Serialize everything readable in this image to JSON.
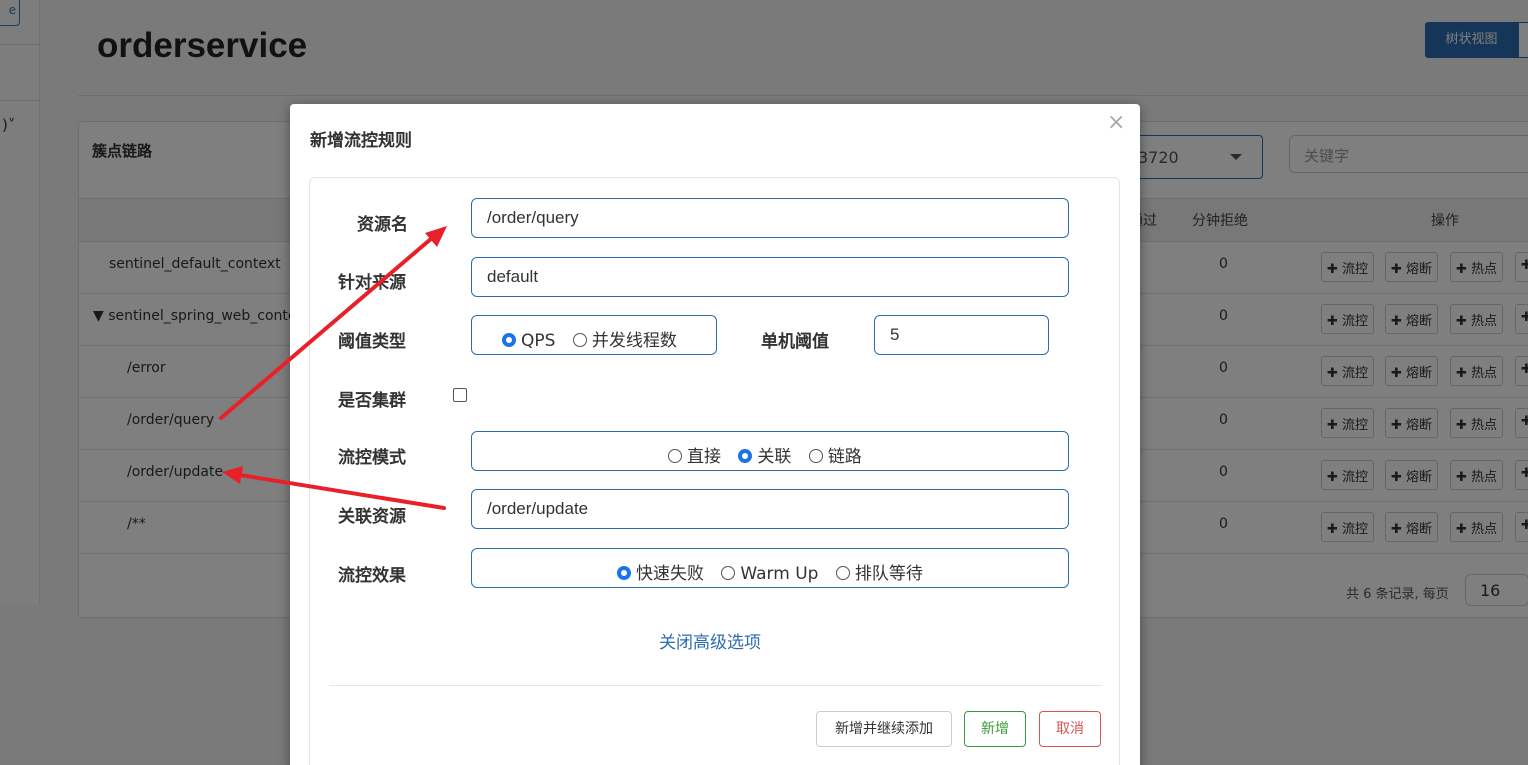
{
  "left_rail": {
    "button_label": "e",
    "caret": ")˅"
  },
  "header": {
    "title": "orderservice",
    "tree_view_button": "树状视图"
  },
  "panel": {
    "title": "簇点链路",
    "machine_select": "3720",
    "keyword_placeholder": "关键字",
    "columns": {
      "passed": "通过",
      "rejected": "分钟拒绝",
      "ops": "操作"
    },
    "rows": [
      {
        "name": "sentinel_default_context",
        "rejected": "0"
      },
      {
        "name": "▼ sentinel_spring_web_conte",
        "rejected": "0"
      },
      {
        "name": "/error",
        "rejected": "0"
      },
      {
        "name": "/order/query",
        "rejected": "0"
      },
      {
        "name": "/order/update",
        "rejected": "0"
      },
      {
        "name": "/**",
        "rejected": "0"
      }
    ],
    "ops": {
      "flow": "✚ 流控",
      "degrade": "✚ 熔断",
      "hot": "✚ 热点",
      "more": "✚"
    },
    "pager": {
      "text": "共 6 条记录, 每页",
      "page_size": "16"
    }
  },
  "modal": {
    "title": "新增流控规则",
    "close": "×",
    "labels": {
      "resource": "资源名",
      "origin": "针对来源",
      "grade": "阈值类型",
      "count": "单机阈值",
      "cluster": "是否集群",
      "strategy": "流控模式",
      "ref_resource": "关联资源",
      "behavior": "流控效果"
    },
    "values": {
      "resource": "/order/query",
      "origin": "default",
      "count": "5",
      "ref_resource": "/order/update"
    },
    "grade_options": {
      "qps": "QPS",
      "threads": "并发线程数"
    },
    "strategy_options": {
      "direct": "直接",
      "relate": "关联",
      "chain": "链路"
    },
    "behavior_options": {
      "fast_fail": "快速失败",
      "warm_up": "Warm Up",
      "queue": "排队等待"
    },
    "selected": {
      "grade": "QPS",
      "strategy": "关联",
      "behavior": "快速失败",
      "cluster": false
    },
    "advanced_link": "关闭高级选项",
    "buttons": {
      "add_continue": "新增并继续添加",
      "add": "新增",
      "cancel": "取消"
    }
  },
  "colors": {
    "primary": "#2b6cb0",
    "arrow": "#e8202a",
    "success": "#3c9a3c",
    "danger": "#d9534f"
  }
}
